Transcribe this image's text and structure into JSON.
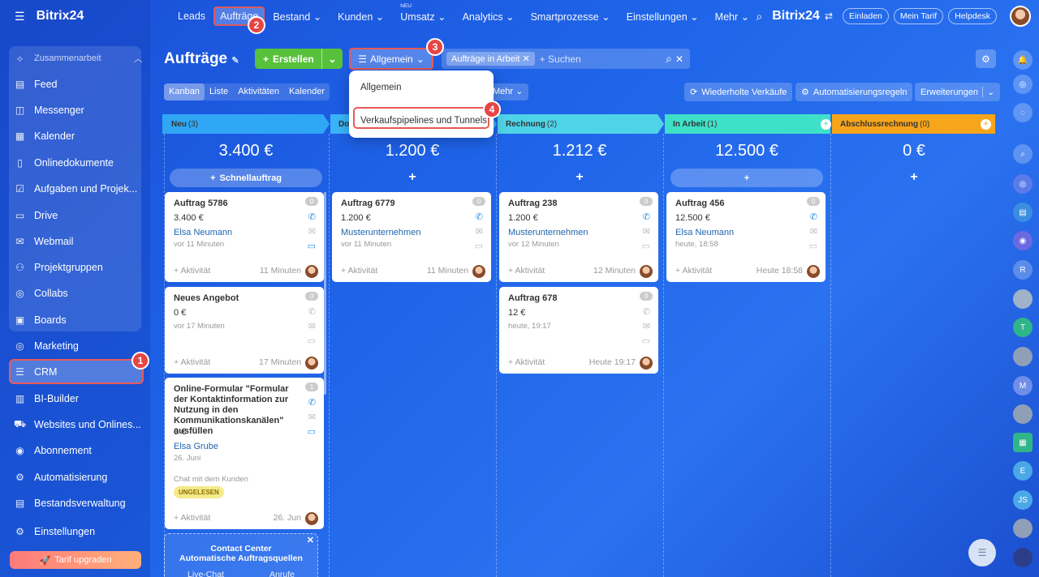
{
  "sidebar": {
    "brand": "Bitrix24",
    "group_label": "Zusammenarbeit",
    "items": [
      {
        "label": "Feed",
        "icon": "feed-icon"
      },
      {
        "label": "Messenger",
        "icon": "chat-icon"
      },
      {
        "label": "Kalender",
        "icon": "calendar-icon"
      },
      {
        "label": "Onlinedokumente",
        "icon": "document-icon"
      },
      {
        "label": "Aufgaben und Projek...",
        "icon": "task-icon"
      },
      {
        "label": "Drive",
        "icon": "drive-icon"
      },
      {
        "label": "Webmail",
        "icon": "mail-icon"
      },
      {
        "label": "Projektgruppen",
        "icon": "group-icon"
      },
      {
        "label": "Collabs",
        "icon": "collab-icon"
      },
      {
        "label": "Boards",
        "icon": "board-icon"
      }
    ],
    "items2": [
      {
        "label": "Marketing",
        "icon": "target-icon"
      },
      {
        "label": "CRM",
        "icon": "filter-icon"
      },
      {
        "label": "BI-Builder",
        "icon": "chart-icon"
      },
      {
        "label": "Websites und Onlines...",
        "icon": "cart-icon"
      },
      {
        "label": "Abonnement",
        "icon": "subscription-icon"
      },
      {
        "label": "Automatisierung",
        "icon": "robot-icon"
      },
      {
        "label": "Bestandsverwaltung",
        "icon": "warehouse-icon"
      },
      {
        "label": "Einstellungen",
        "icon": "gear-icon"
      }
    ],
    "upgrade": "Tarif upgraden"
  },
  "topnav": {
    "items": [
      "Leads",
      "Aufträge",
      "Bestand",
      "Kunden",
      "Umsatz",
      "Analytics",
      "Smartprozesse",
      "Einstellungen",
      "Mehr"
    ],
    "new_badge": "NEU",
    "brand": "Bitrix24",
    "buttons": [
      "Einladen",
      "Mein Tarif",
      "Helpdesk"
    ]
  },
  "toolbar": {
    "title": "Aufträge",
    "create": "Erstellen",
    "pipeline": "Allgemein",
    "filter_chip": "Aufträge in Arbeit",
    "search_placeholder": "+ Suchen"
  },
  "views": [
    "Kanban",
    "Liste",
    "Aktivitäten",
    "Kalender"
  ],
  "mehr": "Mehr",
  "actions": [
    "Wiederholte Verkäufe",
    "Automatisierungsregeln",
    "Erweiterungen"
  ],
  "dropdown": {
    "items": [
      "Allgemein",
      "Verkaufspipelines und Tunnels"
    ]
  },
  "badges": [
    "1",
    "2",
    "3",
    "4"
  ],
  "columns": [
    {
      "name": "Neu",
      "count": "(3)",
      "sum": "3.400 €",
      "color": "#2fa7f5",
      "add": "Schnellauftrag"
    },
    {
      "name": "Do",
      "count": "",
      "sum": "1.200 €",
      "color": "#39b4f7"
    },
    {
      "name": "Rechnung",
      "count": "(2)",
      "sum": "1.212 €",
      "color": "#4fd3e6"
    },
    {
      "name": "In Arbeit",
      "count": "(1)",
      "sum": "12.500 €",
      "color": "#3fe0c8"
    },
    {
      "name": "Abschlussrechnung",
      "count": "(0)",
      "sum": "0 €",
      "color": "#f7a51a"
    }
  ],
  "cards": {
    "c1": {
      "title": "Auftrag 5786",
      "amount": "3.400 €",
      "client": "Elsa Neumann",
      "when": "vor 11 Minuten",
      "act": "+ Aktivität",
      "time": "11 Minuten",
      "count": "0"
    },
    "c2": {
      "title": "Neues Angebot",
      "amount": "0 €",
      "when": "vor 17 Minuten",
      "act": "+ Aktivität",
      "time": "17 Minuten",
      "count": "0"
    },
    "c3": {
      "title": "Online-Formular \"Formular der Kontaktinformation zur Nutzung in den Kommunikationskanälen\" ausfüllen",
      "amount": "0 €",
      "client": "Elsa Grube",
      "when": "26. Juni",
      "note": "Chat mit dem Kunden",
      "tag": "UNGELESEN",
      "act": "+ Aktivität",
      "time": "26. Jun",
      "count": "1"
    },
    "c4": {
      "title": "Auftrag 6779",
      "amount": "1.200 €",
      "client": "Musterunternehmen",
      "when": "vor 11 Minuten",
      "act": "+ Aktivität",
      "time": "11 Minuten",
      "count": "0"
    },
    "c5": {
      "title": "Auftrag 238",
      "amount": "1.200 €",
      "client": "Musterunternehmen",
      "when": "vor 12 Minuten",
      "act": "+ Aktivität",
      "time": "12 Minuten",
      "count": "0"
    },
    "c6": {
      "title": "Auftrag 678",
      "amount": "12 €",
      "when": "heute, 19:17",
      "act": "+ Aktivität",
      "time": "Heute 19:17",
      "count": "0"
    },
    "c7": {
      "title": "Auftrag 456",
      "amount": "12.500 €",
      "client": "Elsa Neumann",
      "when": "heute, 18:58",
      "act": "+ Aktivität",
      "time": "Heute 18:58",
      "count": "0"
    }
  },
  "contact_center": {
    "title": "Contact Center",
    "subtitle": "Automatische Auftragsquellen",
    "a": "Live-Chat",
    "b": "Anrufe"
  },
  "right_rail": [
    "R",
    "T",
    "M",
    "E",
    "JS"
  ]
}
